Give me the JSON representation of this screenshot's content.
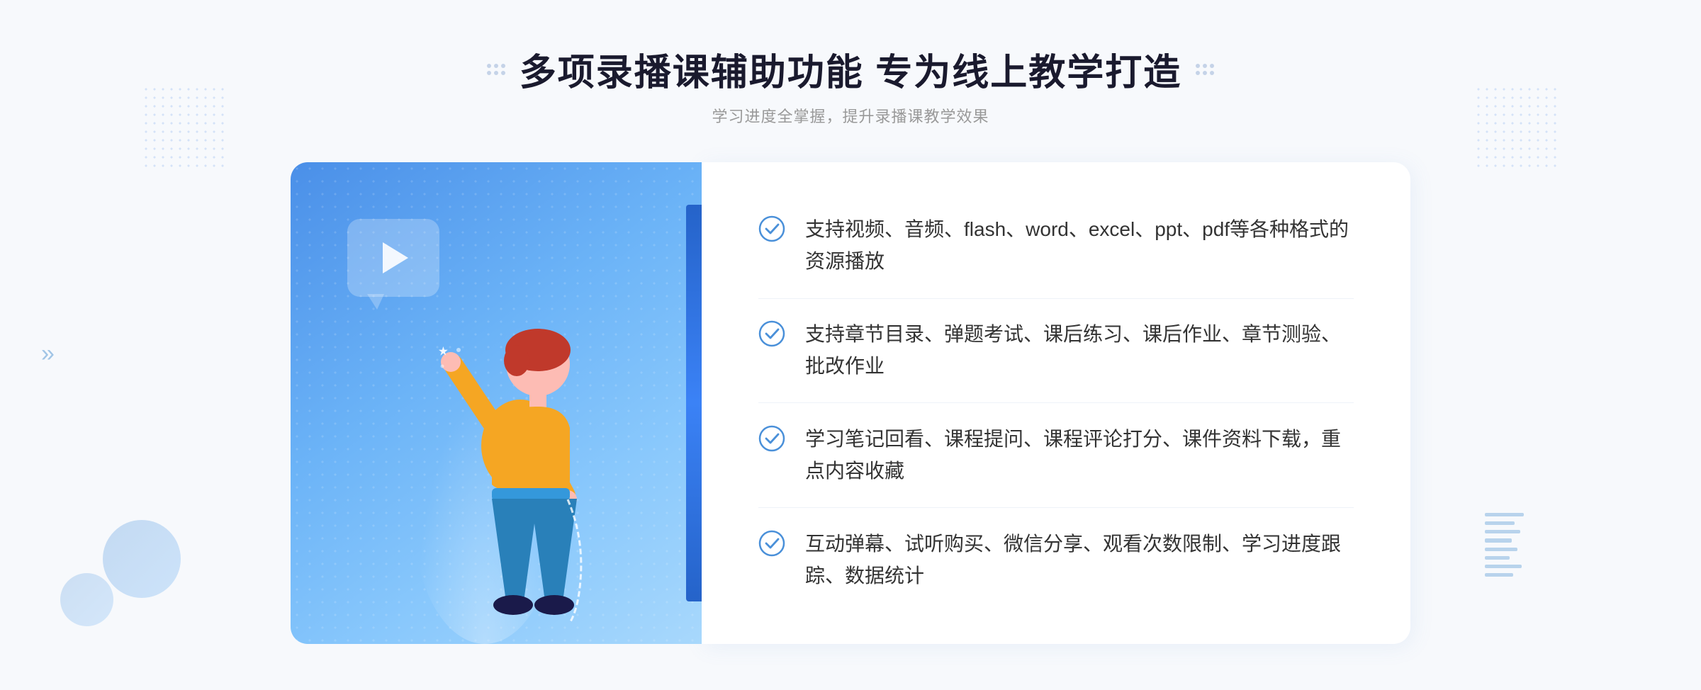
{
  "header": {
    "title": "多项录播课辅助功能 专为线上教学打造",
    "subtitle": "学习进度全掌握，提升录播课教学效果",
    "decoration_dots": "···  ···"
  },
  "features": [
    {
      "id": 1,
      "text": "支持视频、音频、flash、word、excel、ppt、pdf等各种格式的资源播放"
    },
    {
      "id": 2,
      "text": "支持章节目录、弹题考试、课后练习、课后作业、章节测验、批改作业"
    },
    {
      "id": 3,
      "text": "学习笔记回看、课程提问、课程评论打分、课件资料下载，重点内容收藏"
    },
    {
      "id": 4,
      "text": "互动弹幕、试听购买、微信分享、观看次数限制、学习进度跟踪、数据统计"
    }
  ],
  "colors": {
    "primary_blue": "#4a8fe8",
    "light_blue": "#6bb3f7",
    "text_dark": "#1a1a2e",
    "text_gray": "#999999",
    "text_body": "#333333",
    "check_blue": "#4a90d9",
    "bg_white": "#ffffff",
    "bg_light": "#f7f9fc"
  }
}
